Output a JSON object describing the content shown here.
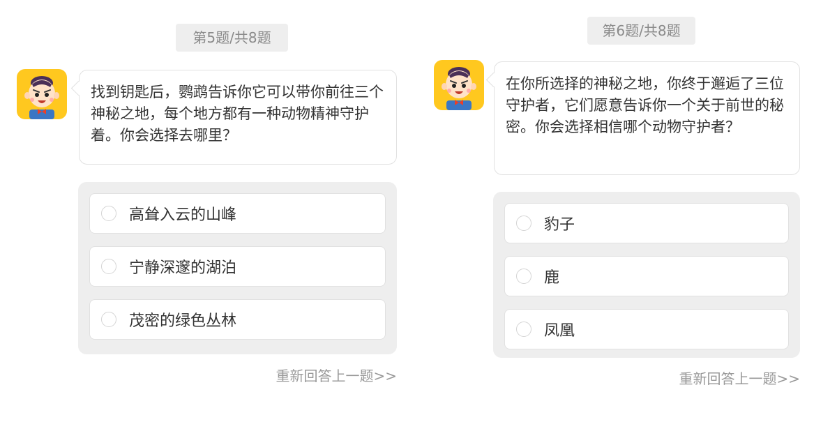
{
  "left": {
    "counter": "第5题/共8题",
    "question": "找到钥匙后，鹦鹉告诉你它可以带你前往三个神秘之地，每个地方都有一种动物精神守护着。你会选择去哪里？",
    "options": [
      "高耸入云的山峰",
      "宁静深邃的湖泊",
      "茂密的绿色丛林"
    ],
    "redo_link": "重新回答上一题>>"
  },
  "right": {
    "counter": "第6题/共8题",
    "question": "在你所选择的神秘之地，你终于邂逅了三位守护者，它们愿意告诉你一个关于前世的秘密。你会选择相信哪个动物守护者？",
    "options": [
      "豹子",
      "鹿",
      "凤凰"
    ],
    "redo_link": "重新回答上一题>>"
  },
  "avatar_icon": "cartoon-boy-avatar-icon",
  "colors": {
    "avatar_bg": "#ffc81f",
    "panel_gray": "#eeeeee",
    "border": "#e1e1e1",
    "muted_text": "#999999",
    "bow_tie": "#e8402a",
    "shirt": "#3a76c4"
  }
}
